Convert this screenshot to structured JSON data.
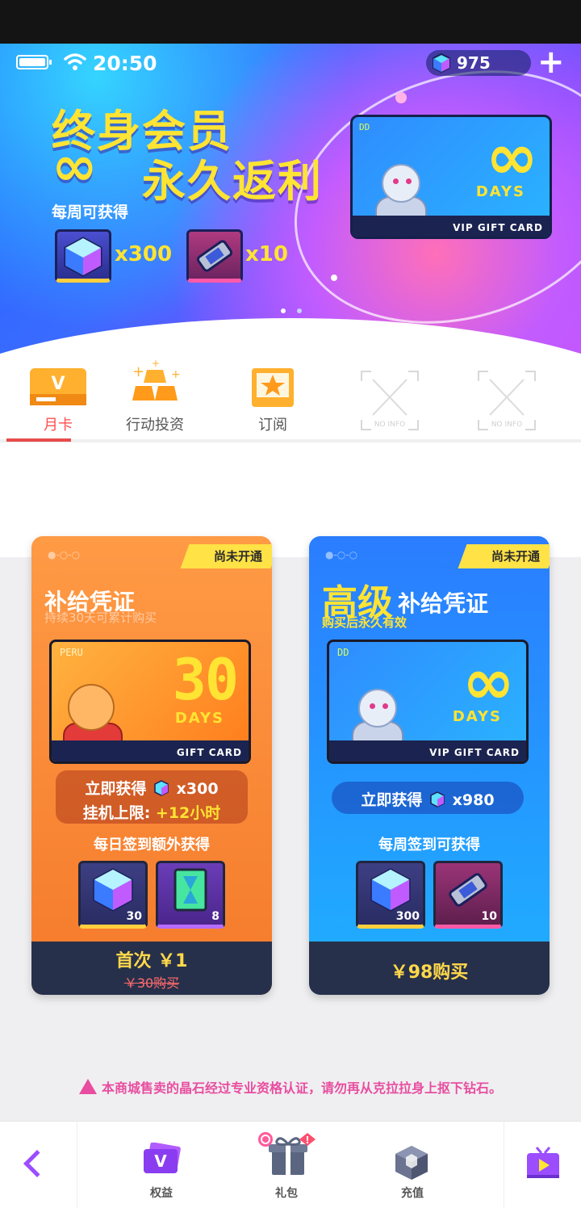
{
  "status_bar": {
    "time": "20:50",
    "currency": "975"
  },
  "banner": {
    "title_line1": "终身会员",
    "infinity": "∞",
    "title_line2": "永久返利",
    "subtitle": "每周可获得",
    "reward_gem_qty": "x300",
    "reward_ticket_qty": "x10",
    "card": {
      "tag": "DD",
      "infinity": "∞",
      "days": "DAYS",
      "label": "VIP GIFT CARD"
    },
    "page_dots": 2,
    "active_dot": 0
  },
  "tabs": [
    {
      "label": "月卡",
      "icon": "monthly-card-icon",
      "active": true
    },
    {
      "label": "行动投资",
      "icon": "gold-bars-icon",
      "active": false
    },
    {
      "label": "订阅",
      "icon": "subscription-star-icon",
      "active": false
    },
    {
      "label": "NO INFO",
      "icon": "no-info-icon",
      "active": false
    },
    {
      "label": "NO INFO",
      "icon": "no-info-icon",
      "active": false
    }
  ],
  "cards": {
    "basic": {
      "ribbon": "尚未开通",
      "title": "补给凭证",
      "subtitle": "持续30天可累计购买",
      "gift_card": {
        "tag": "PERU",
        "number": "30",
        "days": "DAYS",
        "label": "GIFT CARD"
      },
      "instant_prefix": "立即获得",
      "instant_qty": "x300",
      "idle_prefix": "挂机上限:",
      "idle_value": "+12小时",
      "daily_label": "每日签到额外获得",
      "rewards": [
        {
          "icon": "gem-cube-icon",
          "count": "30"
        },
        {
          "icon": "hourglass-card-icon",
          "count": "8"
        }
      ],
      "price": "首次 ￥1",
      "old_price": "￥30购买"
    },
    "premium": {
      "ribbon": "尚未开通",
      "title_big": "高级",
      "title_rest": "补给凭证",
      "subtitle": "购买后永久有效",
      "gift_card": {
        "tag": "DD",
        "infinity": "∞",
        "days": "DAYS",
        "label": "VIP GIFT CARD"
      },
      "instant_prefix": "立即获得",
      "instant_qty": "x980",
      "weekly_label": "每周签到可获得",
      "rewards": [
        {
          "icon": "gem-cube-icon",
          "count": "300"
        },
        {
          "icon": "ticket-icon",
          "count": "10"
        }
      ],
      "price": "￥98购买"
    }
  },
  "notice": "本商城售卖的晶石经过专业资格认证，请勿再从克拉拉身上抠下钻石。",
  "bottom_nav": {
    "items": [
      {
        "label": "权益",
        "icon": "vip-card-icon"
      },
      {
        "label": "礼包",
        "icon": "gift-box-icon"
      },
      {
        "label": "充值",
        "icon": "cube-icon"
      }
    ]
  },
  "colors": {
    "accent": "#9b4dff",
    "active_tab": "#ff4d4d",
    "gold": "#ffe433",
    "notice": "#e84da0"
  }
}
